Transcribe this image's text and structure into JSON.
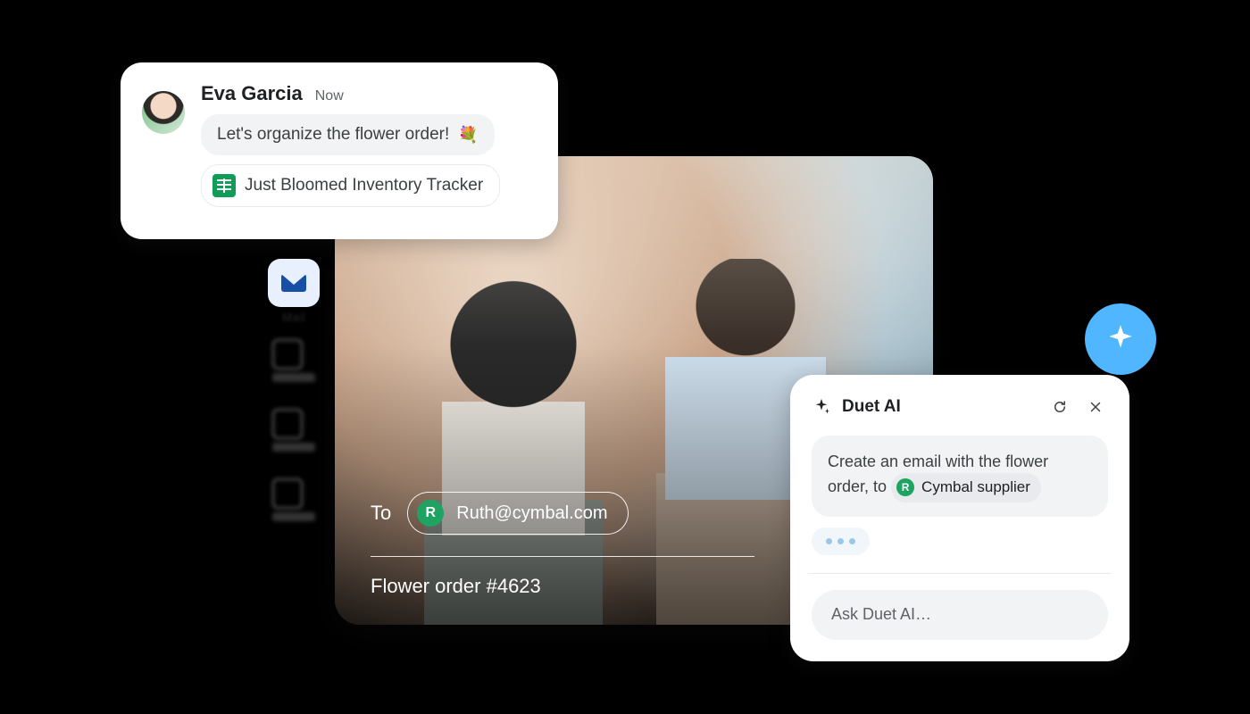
{
  "chat": {
    "sender_name": "Eva Garcia",
    "timestamp": "Now",
    "message_text": "Let's organize the flower order!",
    "message_emoji": "💐",
    "attachment_name": "Just Bloomed Inventory Tracker",
    "attachment_icon": "sheets-icon"
  },
  "mail_rail": {
    "label": "Mail"
  },
  "email_compose": {
    "to_label": "To",
    "recipient_initial": "R",
    "recipient_address": "Ruth@cymbal.com",
    "subject": "Flower order #4623"
  },
  "duet": {
    "title": "Duet AI",
    "prompt_prefix": "Create an email with the flower order, to ",
    "supplier_initial": "R",
    "supplier_name": "Cymbal supplier",
    "input_placeholder": "Ask Duet AI…"
  },
  "icons": {
    "refresh": "refresh-icon",
    "close": "close-icon",
    "sparkle": "sparkle-icon",
    "mail": "mail-icon"
  },
  "colors": {
    "accent_blue": "#4fb6ff",
    "green_avatar": "#1ea362",
    "sheets_green": "#0f9d58"
  }
}
